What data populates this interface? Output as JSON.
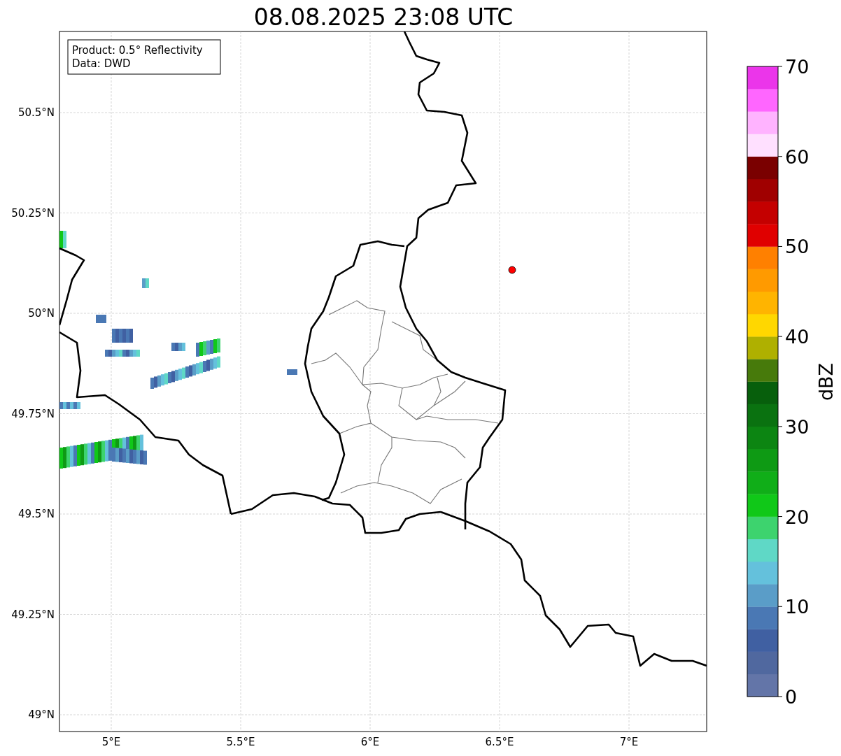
{
  "title": "08.08.2025 23:08 UTC",
  "info_box": {
    "lines": [
      "Product: 0.5° Reflectivity",
      "Data: DWD"
    ]
  },
  "map": {
    "x_ticks": [
      "5°E",
      "5.5°E",
      "6°E",
      "6.5°E",
      "7°E"
    ],
    "y_ticks": [
      "50.5°N",
      "50.25°N",
      "50°N",
      "49.75°N",
      "49.5°N",
      "49.25°N",
      "49°N"
    ]
  },
  "colorbar": {
    "label": "dBZ",
    "ticks": [
      "70",
      "60",
      "50",
      "40",
      "30",
      "20",
      "10",
      "0"
    ],
    "bins": [
      {
        "color": "#6375a8"
      },
      {
        "color": "#50689f"
      },
      {
        "color": "#4060a2"
      },
      {
        "color": "#4a78b4"
      },
      {
        "color": "#5a9dc8"
      },
      {
        "color": "#64c1dc"
      },
      {
        "color": "#5fd8c6"
      },
      {
        "color": "#3dd36e"
      },
      {
        "color": "#10c818"
      },
      {
        "color": "#10ae18"
      },
      {
        "color": "#0e9a14"
      },
      {
        "color": "#0c8512"
      },
      {
        "color": "#0a7210"
      },
      {
        "color": "#075f0c"
      },
      {
        "color": "#477a0b"
      },
      {
        "color": "#afb000"
      },
      {
        "color": "#ffd700"
      },
      {
        "color": "#ffb400"
      },
      {
        "color": "#ff9a00"
      },
      {
        "color": "#ff8000"
      },
      {
        "color": "#e00000"
      },
      {
        "color": "#c40000"
      },
      {
        "color": "#a00000"
      },
      {
        "color": "#7a0000"
      },
      {
        "color": "#ffe0ff"
      },
      {
        "color": "#ffb3ff"
      },
      {
        "color": "#ff66ff"
      },
      {
        "color": "#eb35ea"
      }
    ]
  }
}
